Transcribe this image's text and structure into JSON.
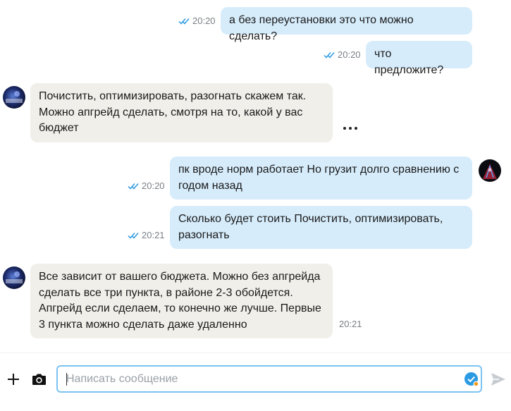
{
  "chat": {
    "messages": [
      {
        "id": "m1",
        "dir": "out",
        "lines": [
          "а без переустановки это что можно сделать?"
        ],
        "time": "20:20",
        "read": true
      },
      {
        "id": "m2",
        "dir": "out",
        "lines": [
          "что предложите?"
        ],
        "time": "20:20",
        "read": true
      },
      {
        "id": "m3",
        "dir": "in",
        "lines": [
          "Почистить, оптимизировать, разогнать скажем так.",
          "Можно апгрейд сделать, смотря на то, какой у вас",
          "бюджет"
        ],
        "time": ""
      },
      {
        "id": "m4",
        "dir": "out",
        "lines": [
          "пк вроде норм работает Но грузит долго сравнению с",
          "годом назад"
        ],
        "time": "20:20",
        "read": true
      },
      {
        "id": "m5",
        "dir": "out",
        "lines": [
          "Сколько будет стоить Почистить, оптимизировать,",
          "разогнать"
        ],
        "time": "20:21",
        "read": true
      },
      {
        "id": "m6",
        "dir": "in",
        "lines": [
          "Все зависит от вашего бюджета. Можно без апгрейда",
          "сделать все три пункта, в районе 2-3 обойдется.",
          "Апгрейд если сделаем, то конечно же лучше. Первые",
          "3 пункта можно сделать даже удаленно"
        ],
        "time": "20:21"
      }
    ]
  },
  "composer": {
    "placeholder": "Написать сообщение",
    "value": ""
  },
  "icons": {
    "add": "plus-icon",
    "camera": "camera-icon",
    "check_badge": "check-badge-icon",
    "send": "send-icon",
    "more": "more-dots-icon",
    "read": "double-check-icon"
  },
  "colors": {
    "outgoing_bubble": "#d6ecfb",
    "incoming_bubble": "#f1efe9",
    "accent": "#2a9ae2",
    "input_border": "#7cc2f0"
  }
}
